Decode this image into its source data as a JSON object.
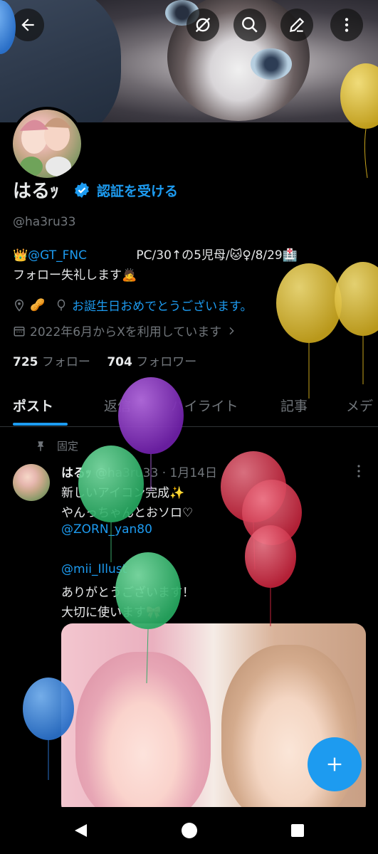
{
  "header": {
    "back_icon": "arrow-left-icon",
    "actions": [
      "sync-icon",
      "search-icon",
      "edit-icon",
      "more-vertical-icon"
    ]
  },
  "profile": {
    "name": "はるｯ",
    "get_verified": "認証を受ける",
    "handle": "@ha3ru33",
    "bio_line1_prefix": "👑",
    "bio_line1_link": "@GT_FNC",
    "bio_line1_text": "PC/30↑の5児母/🐱♀/8/29🏥",
    "bio_line2": "フォロー失礼します🙇",
    "location": "🥜",
    "website": "お誕生日おめでとうございます。",
    "joined": "2022年6月からXを利用しています",
    "following_count": "725",
    "following_label": "フォロー",
    "followers_count": "704",
    "followers_label": "フォロワー"
  },
  "tabs": [
    {
      "label": "ポスト",
      "active": true
    },
    {
      "label": "返信"
    },
    {
      "label": "ハイライト"
    },
    {
      "label": "記事"
    },
    {
      "label": "メデ"
    }
  ],
  "post": {
    "pinned_label": "固定",
    "author_name": "はるｯ",
    "author_meta": "@ha3ru33 · 1月14日",
    "lines": [
      "新しいアイコン完成✨",
      "やんっちゃんとおソロ♡",
      "@ZORN_yan80",
      "",
      "@mii_Illust",
      "ありがとうございます！",
      "大切に使います🎀"
    ]
  },
  "fab_icon": "plus-icon",
  "system_nav": [
    "back-triangle-icon",
    "home-circle-icon",
    "recents-square-icon"
  ],
  "colors": {
    "accent": "#1d9bf0",
    "text": "#e7e9ea",
    "muted": "#71767b",
    "background": "#000000"
  }
}
